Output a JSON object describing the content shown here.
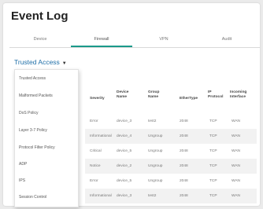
{
  "page": {
    "title": "Event Log"
  },
  "tabs": [
    {
      "label": "Device"
    },
    {
      "label": "Firewall"
    },
    {
      "label": "VPN"
    },
    {
      "label": "Audit"
    }
  ],
  "filter": {
    "selected": "Trusted Access",
    "options": [
      "Trusted Access",
      "Malformed Packets",
      "DoS Policy",
      "Layer 3-7 Policy",
      "Protocol Filter Policy",
      "ADP",
      "IPS",
      "Session Control"
    ]
  },
  "table": {
    "columns": [
      {
        "label": "Severity"
      },
      {
        "label": "Device Name"
      },
      {
        "label": "Group Name"
      },
      {
        "label": "EtherType"
      },
      {
        "label": "IP Protocol"
      },
      {
        "label": "Incoming Interface"
      }
    ],
    "rows": [
      [
        "Error",
        "device_3",
        "test2",
        "2048",
        "TCP",
        "WAN"
      ],
      [
        "Informational",
        "device_4",
        "Ungroup",
        "2048",
        "TCP",
        "WAN"
      ],
      [
        "Critical",
        "device_5",
        "Ungroup",
        "2048",
        "TCP",
        "WAN"
      ],
      [
        "Notice",
        "device_2",
        "Ungroup",
        "2048",
        "TCP",
        "WAN"
      ],
      [
        "Error",
        "device_5",
        "Ungroup",
        "2048",
        "TCP",
        "WAN"
      ],
      [
        "Informational",
        "device_3",
        "test2",
        "2048",
        "TCP",
        "WAN"
      ]
    ]
  },
  "colors": {
    "accent": "#1a9a8a",
    "link": "#1f6fa8",
    "row_alt": "#f2f2f2"
  }
}
